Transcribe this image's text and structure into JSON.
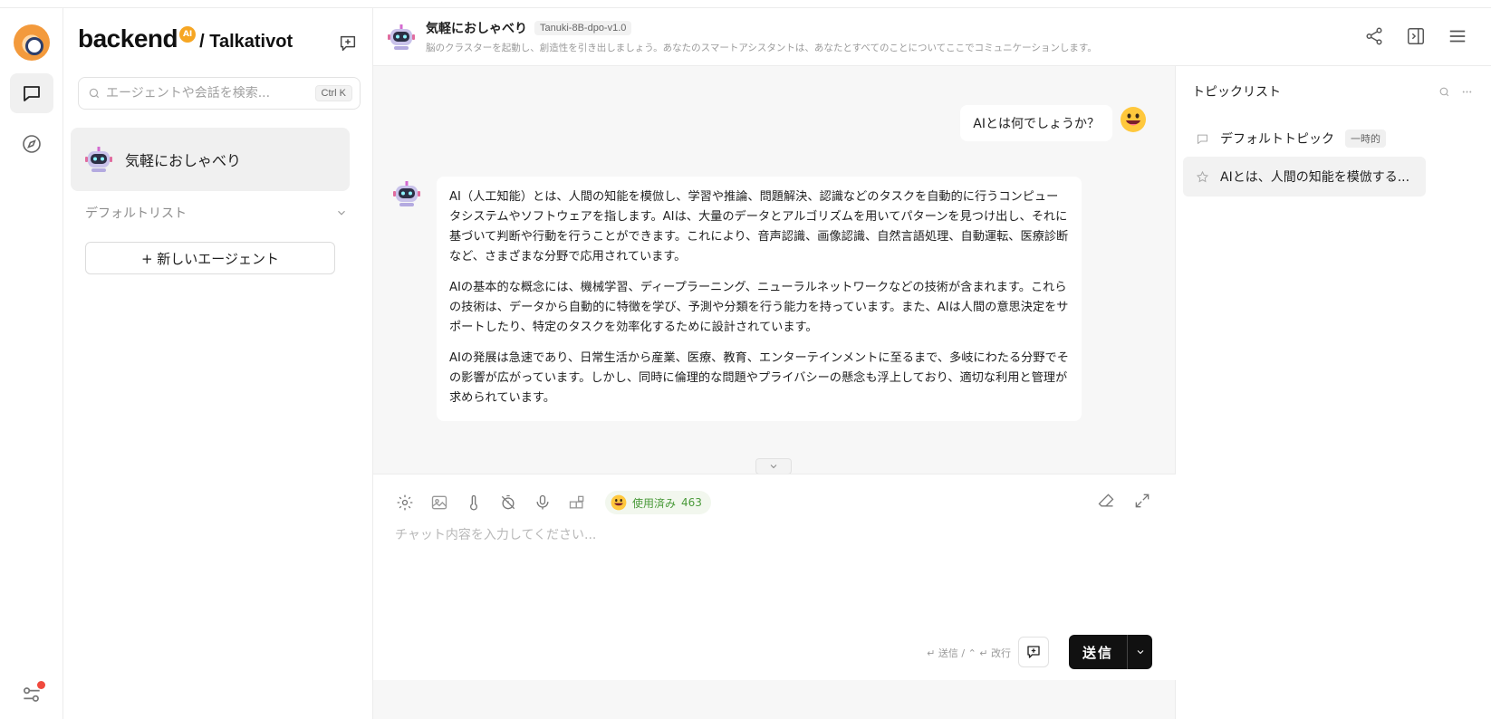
{
  "brand": {
    "name": "backend",
    "badge": "AI",
    "workspace": "/ Talkativot"
  },
  "search": {
    "placeholder": "エージェントや会話を検索...",
    "shortcut": "Ctrl K"
  },
  "sidebar": {
    "agents": [
      {
        "name": "気軽におしゃべり"
      }
    ],
    "list_title": "デフォルトリスト",
    "new_agent_label": "+ 新しいエージェント"
  },
  "header": {
    "title": "気軽におしゃべり",
    "model": "Tanuki-8B-dpo-v1.0",
    "description": "脳のクラスターを起動し、創造性を引き出しましょう。あなたのスマートアシスタントは、あなたとすべてのことについてここでコミュニケーションします。"
  },
  "messages": {
    "user": "AIとは何でしょうか？",
    "assistant": [
      "AI（人工知能）とは、人間の知能を模倣し、学習や推論、問題解決、認識などのタスクを自動的に行うコンピュータシステムやソフトウェアを指します。AIは、大量のデータとアルゴリズムを用いてパターンを見つけ出し、それに基づいて判断や行動を行うことができます。これにより、音声認識、画像認識、自然言語処理、自動運転、医療診断など、さまざまな分野で応用されています。",
      "AIの基本的な概念には、機械学習、ディープラーニング、ニューラルネットワークなどの技術が含まれます。これらの技術は、データから自動的に特徴を学び、予測や分類を行う能力を持っています。また、AIは人間の意思決定をサポートしたり、特定のタスクを効率化するために設計されています。",
      "AIの発展は急速であり、日常生活から産業、医療、教育、エンターテインメントに至るまで、多岐にわたる分野でその影響が広がっています。しかし、同時に倫理的な問題やプライバシーの懸念も浮上しており、適切な利用と管理が求められています。"
    ]
  },
  "composer": {
    "usage_label": "使用済み",
    "usage_count": "463",
    "placeholder": "チャット内容を入力してください...",
    "send_hint": "↵ 送信 / ⌃ ↵ 改行",
    "send_label": "送信"
  },
  "topics": {
    "title": "トピックリスト",
    "items": [
      {
        "label": "デフォルトトピック",
        "tag": "一時的"
      },
      {
        "label": "AIとは、人間の知能を模倣する..."
      }
    ]
  },
  "colors": {
    "accent": "#111111",
    "usage_green": "#4a9a3a",
    "notify_dot": "#f04a3e",
    "brand_orange": "#f6a623"
  },
  "icons": [
    "app-logo-icon",
    "chat-icon",
    "compass-icon",
    "settings-sliders-icon",
    "new-chat-icon",
    "search-icon",
    "chevron-down-icon",
    "share-icon",
    "panel-toggle-icon",
    "menu-icon",
    "settings-icon",
    "image-icon",
    "thermometer-icon",
    "timer-off-icon",
    "microphone-icon",
    "plugin-icon",
    "eraser-icon",
    "expand-icon",
    "comment-icon",
    "star-icon",
    "more-icon"
  ]
}
